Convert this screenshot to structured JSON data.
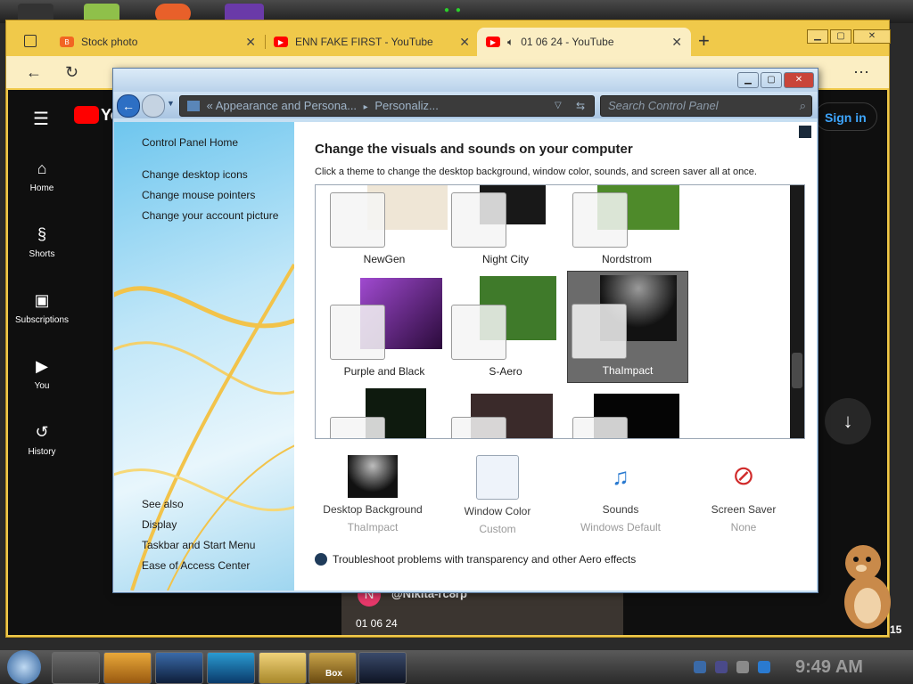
{
  "browser": {
    "tabs": [
      {
        "label": "Stock photo",
        "icon": "blogger-icon",
        "color": "#f26522"
      },
      {
        "label": "ENN FAKE FIRST - YouTube",
        "icon": "youtube-icon",
        "color": "#ff0000"
      },
      {
        "label": "01 06 24 - YouTube",
        "icon": "youtube-icon",
        "color": "#ff0000"
      }
    ],
    "new_tab": "+",
    "close": "✕",
    "more": "⋯"
  },
  "youtube": {
    "logo_text": "Yo",
    "sign_in": "Sign in",
    "sidebar": [
      {
        "label": "Home",
        "icon": "home-icon"
      },
      {
        "label": "Shorts",
        "icon": "shorts-icon"
      },
      {
        "label": "Subscriptions",
        "icon": "subscriptions-icon"
      },
      {
        "label": "You",
        "icon": "you-icon"
      },
      {
        "label": "History",
        "icon": "history-icon"
      }
    ],
    "channel_initial": "N",
    "channel_name": "@Nikita-rc8rp",
    "video_date": "01 06 24",
    "edge_number": "15"
  },
  "control_panel": {
    "breadcrumb_prefix": "«",
    "breadcrumb_1": "Appearance and Persona...",
    "breadcrumb_sep": "▸",
    "breadcrumb_2": "Personaliz...",
    "search_placeholder": "Search Control Panel",
    "left_links": [
      "Control Panel Home",
      "Change desktop icons",
      "Change mouse pointers",
      "Change your account picture"
    ],
    "see_also": "See also",
    "see_also_links": [
      "Display",
      "Taskbar and Start Menu",
      "Ease of Access Center"
    ],
    "heading": "Change the visuals and sounds on your computer",
    "subheading": "Click a theme to change the desktop background, window color, sounds, and screen saver all at once.",
    "themes": [
      {
        "name": "NewGen",
        "bg": "#efe6d6",
        "selected": false
      },
      {
        "name": "Night City",
        "bg": "#181818",
        "selected": false
      },
      {
        "name": "Nordstrom",
        "bg": "#4e8a2a",
        "selected": false
      },
      {
        "name": "Purple and Black",
        "bg": "#6a2a8a",
        "selected": false
      },
      {
        "name": "S-Aero",
        "bg": "#3f7a2a",
        "selected": false
      },
      {
        "name": "ThaImpact",
        "bg": "#121212",
        "selected": true
      },
      {
        "name": "",
        "bg": "#0e1a0e",
        "selected": false
      },
      {
        "name": "",
        "bg": "#3a2a2a",
        "selected": false
      },
      {
        "name": "",
        "bg": "#050505",
        "selected": false
      }
    ],
    "bottom": [
      {
        "name": "Desktop Background",
        "value": "ThaImpact",
        "icon": "desktop-background-icon"
      },
      {
        "name": "Window Color",
        "value": "Custom",
        "icon": "window-color-icon"
      },
      {
        "name": "Sounds",
        "value": "Windows Default",
        "icon": "sounds-icon"
      },
      {
        "name": "Screen Saver",
        "value": "None",
        "icon": "screen-saver-icon"
      }
    ],
    "troubleshoot": "Troubleshoot problems with transparency and other Aero effects"
  },
  "taskbar": {
    "clock": "9:49 AM",
    "box_label": "Box"
  }
}
